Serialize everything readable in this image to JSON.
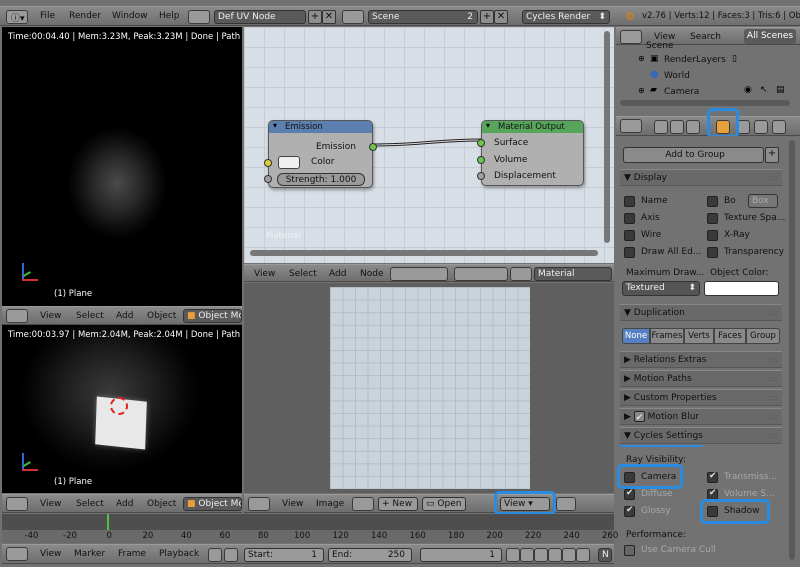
{
  "topbar": {
    "menus": [
      "File",
      "Render",
      "Window",
      "Help"
    ],
    "screen_layout": "Def UV Node",
    "scene": "Scene",
    "scene_users": "2",
    "engine": "Cycles Render",
    "stats": "v2.76 | Verts:12 | Faces:3 | Tris:6 | Obje"
  },
  "viewport_top": {
    "info": "Time:00:04.40 | Mem:3.23M, Peak:3.23M | Done | Path Tra",
    "object_label": "(1) Plane"
  },
  "viewport_top_header": {
    "menus": [
      "View",
      "Select",
      "Add",
      "Object"
    ],
    "mode": "Object Mo"
  },
  "viewport_bottom": {
    "info": "Time:00:03.97 | Mem:2.04M, Peak:2.04M | Done | Path Tra",
    "object_label": "(1) Plane"
  },
  "viewport_bottom_header": {
    "menus": [
      "View",
      "Select",
      "Add",
      "Object"
    ],
    "mode": "Object Mo"
  },
  "node_editor": {
    "watermark": "Material",
    "emission_node": {
      "title": "Emission",
      "output": "Emission",
      "color_label": "Color",
      "strength": "Strength: 1.000"
    },
    "output_node": {
      "title": "Material Output",
      "inputs": [
        "Surface",
        "Volume",
        "Displacement"
      ]
    },
    "header": {
      "menus": [
        "View",
        "Select",
        "Add",
        "Node"
      ],
      "material": "Material"
    }
  },
  "uv_editor": {
    "header": {
      "menus": [
        "View",
        "Image"
      ],
      "new_label": "New",
      "open_label": "Open",
      "view_label": "View"
    }
  },
  "outliner": {
    "tabs": [
      "View",
      "Search",
      "All Scenes"
    ],
    "items": [
      "Scene",
      "RenderLayers",
      "World",
      "Camera"
    ]
  },
  "properties": {
    "add_to_group": "Add to Group",
    "display": {
      "title": "Display",
      "left": [
        "Name",
        "Axis",
        "Wire",
        "Draw All Ed..."
      ],
      "right": [
        "Bo",
        "Texture Spa...",
        "X-Ray",
        "Transparency"
      ],
      "box_label": "Box",
      "max_draw_label": "Maximum Draw...",
      "object_color_label": "Object Color:",
      "max_draw_value": "Textured"
    },
    "duplication": {
      "title": "Duplication",
      "options": [
        "None",
        "Frames",
        "Verts",
        "Faces",
        "Group"
      ],
      "selected": "None"
    },
    "collapsed_panels": [
      "Relations Extras",
      "Motion Paths",
      "Custom Properties",
      "Motion Blur"
    ],
    "cycles": {
      "title": "Cycles Settings",
      "ray_visibility_label": "Ray Visibility:",
      "left": [
        "Camera",
        "Diffuse",
        "Glossy"
      ],
      "right": [
        "Transmiss...",
        "Volume S...",
        "Shadow"
      ],
      "performance_label": "Performance:",
      "use_camera_cull": "Use Camera Cull"
    }
  },
  "timeline": {
    "ticks": [
      "-40",
      "-20",
      "0",
      "20",
      "40",
      "60",
      "80",
      "100",
      "120",
      "140",
      "160",
      "180",
      "200",
      "220",
      "240",
      "260"
    ],
    "current_frame": 0,
    "menus": [
      "View",
      "Marker",
      "Frame",
      "Playback"
    ],
    "start": "Start:",
    "start_value": "1",
    "end": "End:",
    "end_value": "250",
    "frame_value": "1",
    "no_sync": "N"
  },
  "colors": {
    "highlight": "#2a8ce0",
    "emission_title": "#5b7fae",
    "output_title": "#56a55a",
    "socket_yellow": "#d8d23a",
    "socket_green": "#6cc54a",
    "socket_gray": "#a0a0a0"
  }
}
